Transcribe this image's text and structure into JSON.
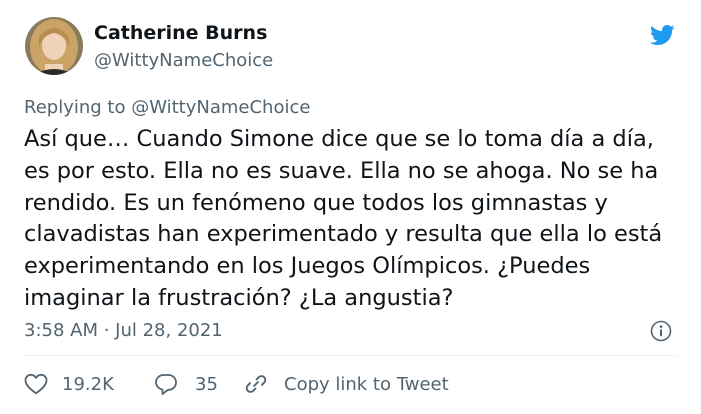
{
  "author": {
    "display_name": "Catherine Burns",
    "handle": "@WittyNameChoice",
    "avatar_icon": "profile-photo"
  },
  "brand": {
    "icon": "twitter-bird-icon",
    "color": "#1d9bf0"
  },
  "replying_to": "Replying to @WittyNameChoice",
  "tweet": {
    "lines": [
      "Así que… Cuando Simone dice que se lo toma día a día,",
      "es por esto. Ella no es suave. Ella no se ahoga. No se ha",
      "rendido. Es un fenómeno que todos los gimnastas y",
      "clavadistas han experimentado y resulta que ella lo está",
      "experimentando en los Juegos Olímpicos. ¿Puedes",
      "imaginar la frustración? ¿La angustia?"
    ]
  },
  "timestamp": "3:58 AM · Jul 28, 2021",
  "actions": {
    "likes": "19.2K",
    "replies": "35",
    "copy_link": "Copy link to Tweet"
  },
  "colors": {
    "text": "#0f1419",
    "secondary": "#536471",
    "divider": "#eff3f4"
  }
}
